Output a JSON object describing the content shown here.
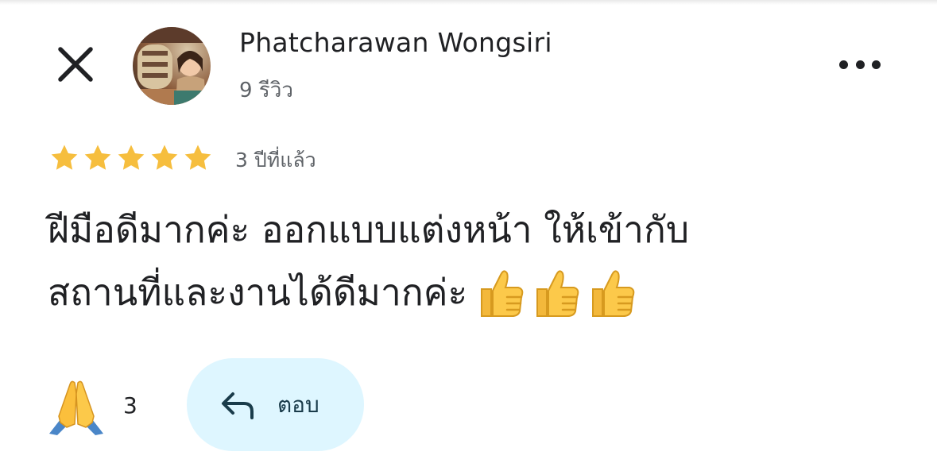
{
  "header": {
    "close_icon": "close-icon",
    "more_icon": "more-horizontal-icon"
  },
  "reviewer": {
    "name": "Phatcharawan Wongsiri",
    "review_count": "9 รีวิว"
  },
  "review": {
    "rating": 5,
    "max_rating": 5,
    "star_color": "#f6be3e",
    "time_ago": "3 ปีที่แล้ว",
    "text_line1": "ฝีมือดีมากค่ะ ออกแบบแต่งหน้า ให้เข้ากับ",
    "text_line2": "สถานที่และงานได้ดีมากค่ะ",
    "emoji": "thumbs-up",
    "emoji_count": 3
  },
  "actions": {
    "reaction_icon": "folded-hands-icon",
    "reaction_count": "3",
    "reply_label": "ตอบ",
    "reply_bg": "#def6ff"
  }
}
